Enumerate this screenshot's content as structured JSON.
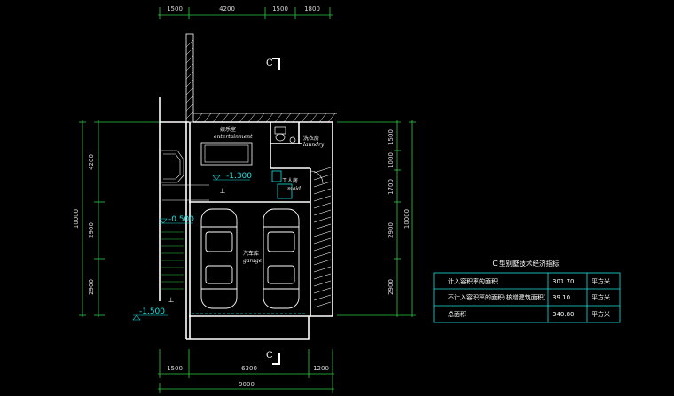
{
  "plan": {
    "top_dims": [
      "1500",
      "4200",
      "1500",
      "1800"
    ],
    "bottom_dims": [
      "1500",
      "6300",
      "1200"
    ],
    "bottom_total": "9000",
    "left_dims": [
      "4200",
      "2900",
      "2900"
    ],
    "left_total": "10000",
    "right_dims": [
      "1500",
      "1000",
      "1700",
      "2900",
      "2900"
    ],
    "right_total": "10000",
    "section_marks": [
      "C",
      "C"
    ],
    "levels": [
      "-1.300",
      "-0.500",
      "-1.500"
    ],
    "up_marks": [
      "上",
      "上"
    ],
    "rooms": {
      "entertainment_cn": "娱乐室",
      "entertainment_en": "entertainment",
      "laundry_cn": "洗衣房",
      "laundry_en": "laundry",
      "maid_cn": "工人房",
      "maid_en": "maid",
      "garage_cn": "汽车库",
      "garage_en": "garage"
    }
  },
  "table": {
    "title": "C 型别墅技术经济指标",
    "rows": [
      {
        "label": "计入容积率的面积",
        "value": "301.70",
        "unit": "平方米"
      },
      {
        "label": "不计入容积率的面积(核增建筑面积)",
        "value": "39.10",
        "unit": "平方米"
      },
      {
        "label": "总面积",
        "value": "340.80",
        "unit": "平方米"
      }
    ]
  },
  "colors": {
    "background": "#000000",
    "wall": "#ffffff",
    "fixture": "#19e0e0",
    "dimension": "#2ecc40",
    "table_border": "#1ee0e0",
    "text": "#ffffff"
  }
}
